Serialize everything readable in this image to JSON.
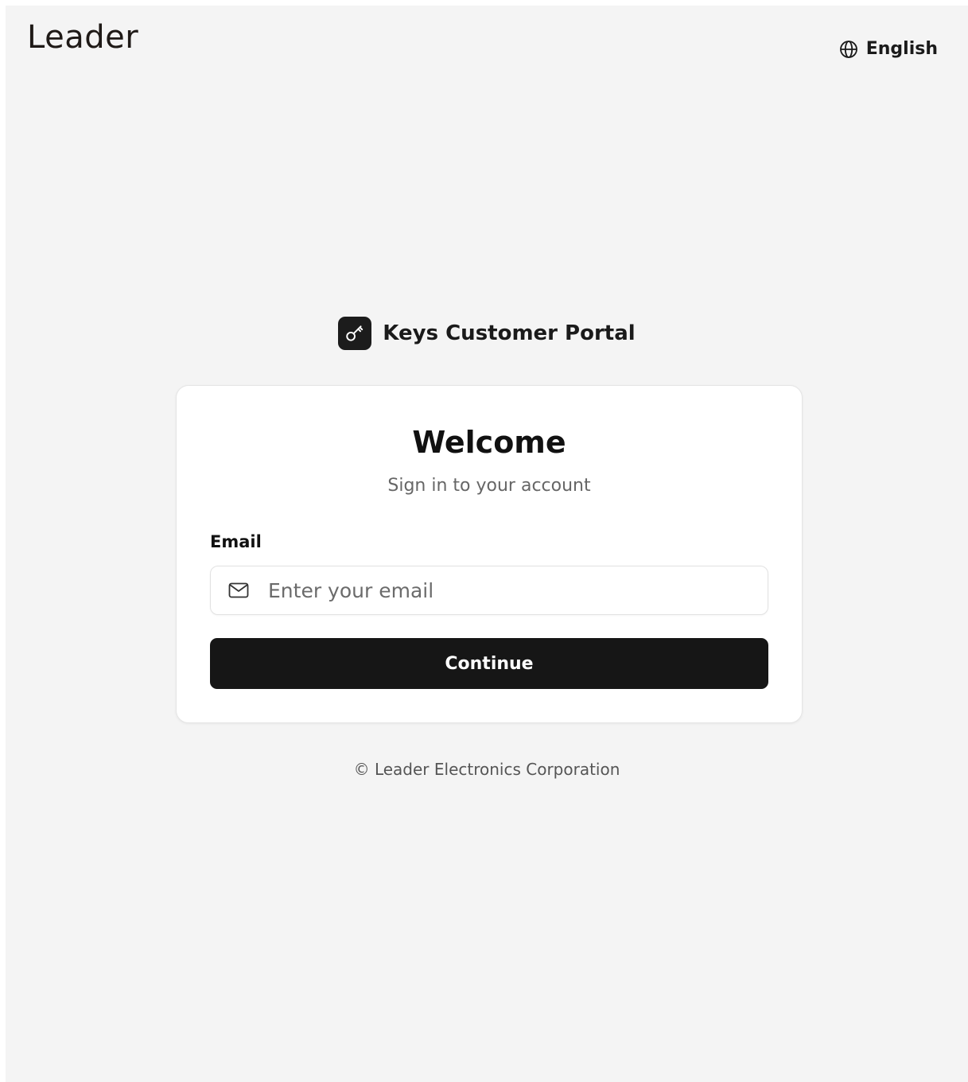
{
  "header": {
    "logo_text": "Leader",
    "language_label": "English",
    "language_icon": "globe-icon"
  },
  "brand": {
    "icon": "key-icon",
    "title": "Keys Customer Portal"
  },
  "login_card": {
    "title": "Welcome",
    "subtitle": "Sign in to your account",
    "email_label": "Email",
    "email_icon": "mail-icon",
    "email_value": "",
    "email_placeholder": "Enter your email",
    "continue_label": "Continue"
  },
  "footer": {
    "copyright": "© Leader Electronics Corporation"
  },
  "colors": {
    "background": "#f4f4f4",
    "card": "#ffffff",
    "button": "#161616",
    "button_text": "#ffffff"
  }
}
